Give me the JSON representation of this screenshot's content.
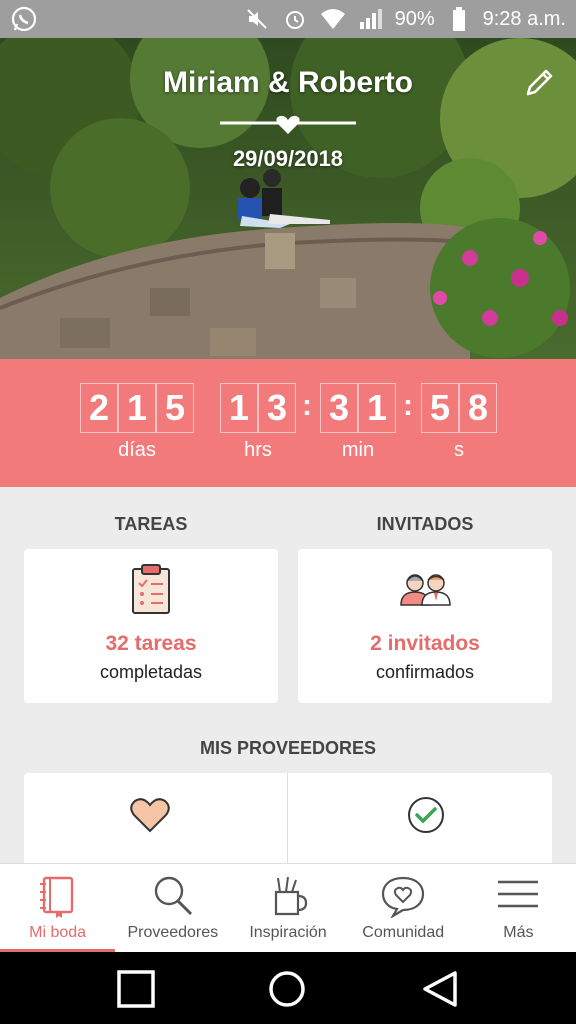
{
  "status_bar": {
    "battery": "90%",
    "time": "9:28 a.m.",
    "icons": [
      "whatsapp-icon",
      "mute-icon",
      "alarm-icon",
      "wifi-icon",
      "signal-icon",
      "battery-icon"
    ]
  },
  "hero": {
    "couple_names": "Miriam & Roberto",
    "wedding_date": "29/09/2018"
  },
  "countdown": {
    "days": [
      "2",
      "1",
      "5"
    ],
    "hours": [
      "1",
      "3"
    ],
    "minutes": [
      "3",
      "1"
    ],
    "seconds": [
      "5",
      "8"
    ],
    "separator": ":",
    "labels": {
      "days": "días",
      "hours": "hrs",
      "minutes": "min",
      "seconds": "s"
    }
  },
  "tasks": {
    "title": "TAREAS",
    "count_text": "32 tareas",
    "status_text": "completadas"
  },
  "guests": {
    "title": "INVITADOS",
    "count_text": "2 invitados",
    "status_text": "confirmados"
  },
  "vendors": {
    "title": "MIS PROVEEDORES"
  },
  "bottom_nav": {
    "items": [
      {
        "label": "Mi boda",
        "icon": "notebook-icon",
        "active": true
      },
      {
        "label": "Proveedores",
        "icon": "search-icon",
        "active": false
      },
      {
        "label": "Inspiración",
        "icon": "inspiration-icon",
        "active": false
      },
      {
        "label": "Comunidad",
        "icon": "chat-heart-icon",
        "active": false
      },
      {
        "label": "Más",
        "icon": "menu-icon",
        "active": false
      }
    ]
  },
  "colors": {
    "accent": "#f27a7a",
    "accent_text": "#e66b6b",
    "background": "#ececec"
  }
}
